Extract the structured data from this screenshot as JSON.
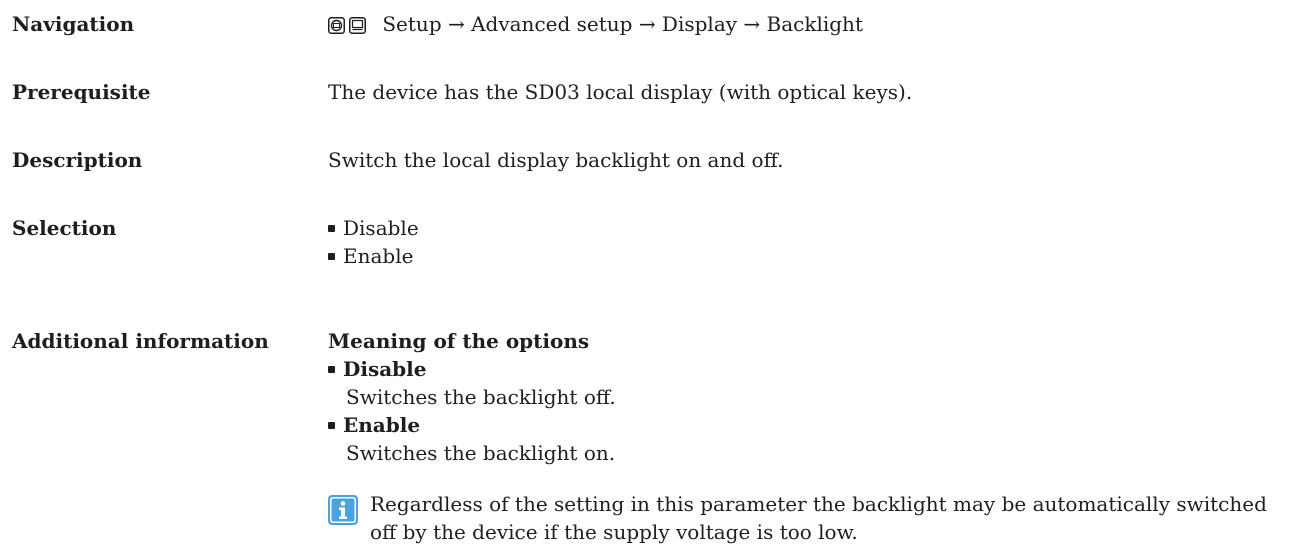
{
  "navigation": {
    "label": "Navigation",
    "icons": [
      "local-display-key-icon",
      "operating-tool-key-icon"
    ],
    "path": "Setup → Advanced setup → Display → Backlight"
  },
  "prerequisite": {
    "label": "Prerequisite",
    "text": "The device has the SD03 local display (with optical keys)."
  },
  "description": {
    "label": "Description",
    "text": "Switch the local display backlight on and off."
  },
  "selection": {
    "label": "Selection",
    "options": [
      "Disable",
      "Enable"
    ]
  },
  "additional_information": {
    "label": "Additional information",
    "heading": "Meaning of the options",
    "options": [
      {
        "name": "Disable",
        "text": "Switches the backlight off."
      },
      {
        "name": "Enable",
        "text": "Switches the backlight on."
      }
    ],
    "note": {
      "icon": "info-icon",
      "text": "Regardless of the setting in this parameter the backlight may be automatically switched off by the device if the supply voltage is too low."
    }
  },
  "colors": {
    "text": "#1e1e1e",
    "info_icon_fill": "#4aa3df"
  }
}
